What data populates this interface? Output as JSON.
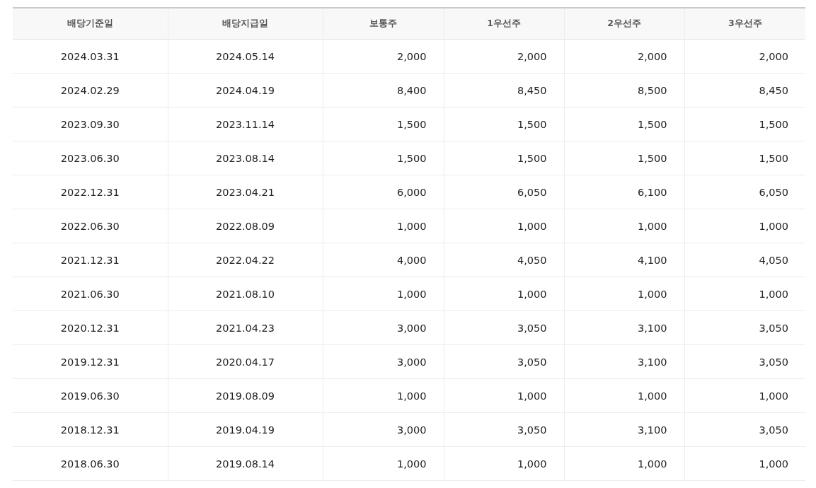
{
  "table": {
    "columns": [
      "배당기준일",
      "배당지급일",
      "보통주",
      "1우선주",
      "2우선주",
      "3우선주"
    ],
    "rows": [
      [
        "2024.03.31",
        "2024.05.14",
        "2,000",
        "2,000",
        "2,000",
        "2,000"
      ],
      [
        "2024.02.29",
        "2024.04.19",
        "8,400",
        "8,450",
        "8,500",
        "8,450"
      ],
      [
        "2023.09.30",
        "2023.11.14",
        "1,500",
        "1,500",
        "1,500",
        "1,500"
      ],
      [
        "2023.06.30",
        "2023.08.14",
        "1,500",
        "1,500",
        "1,500",
        "1,500"
      ],
      [
        "2022.12.31",
        "2023.04.21",
        "6,000",
        "6,050",
        "6,100",
        "6,050"
      ],
      [
        "2022.06.30",
        "2022.08.09",
        "1,000",
        "1,000",
        "1,000",
        "1,000"
      ],
      [
        "2021.12.31",
        "2022.04.22",
        "4,000",
        "4,050",
        "4,100",
        "4,050"
      ],
      [
        "2021.06.30",
        "2021.08.10",
        "1,000",
        "1,000",
        "1,000",
        "1,000"
      ],
      [
        "2020.12.31",
        "2021.04.23",
        "3,000",
        "3,050",
        "3,100",
        "3,050"
      ],
      [
        "2019.12.31",
        "2020.04.17",
        "3,000",
        "3,050",
        "3,100",
        "3,050"
      ],
      [
        "2019.06.30",
        "2019.08.09",
        "1,000",
        "1,000",
        "1,000",
        "1,000"
      ],
      [
        "2018.12.31",
        "2019.04.19",
        "3,000",
        "3,050",
        "3,100",
        "3,050"
      ],
      [
        "2018.06.30",
        "2019.08.14",
        "1,000",
        "1,000",
        "1,000",
        "1,000"
      ]
    ]
  }
}
